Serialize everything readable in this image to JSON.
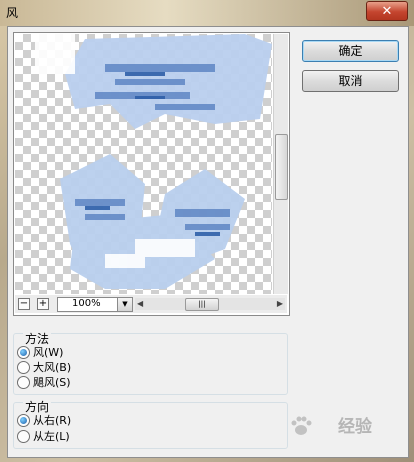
{
  "window": {
    "title": "风",
    "close_glyph": "✕"
  },
  "preview": {
    "zoom_out": "−",
    "zoom_in": "+",
    "zoom_value": "100%",
    "dropdown_glyph": "▼"
  },
  "buttons": {
    "ok": "确定",
    "cancel": "取消"
  },
  "method": {
    "label": "方法",
    "options": [
      {
        "label": "风(W)",
        "selected": true
      },
      {
        "label": "大风(B)",
        "selected": false
      },
      {
        "label": "飓风(S)",
        "selected": false
      }
    ]
  },
  "direction": {
    "label": "方向",
    "options": [
      {
        "label": "从右(R)",
        "selected": true
      },
      {
        "label": "从左(L)",
        "selected": false
      }
    ]
  },
  "watermark": {
    "text": "经验"
  },
  "colors": {
    "accent": "#3c7fb1",
    "close": "#c4452f",
    "radio_dot": "#1e5fa8"
  }
}
